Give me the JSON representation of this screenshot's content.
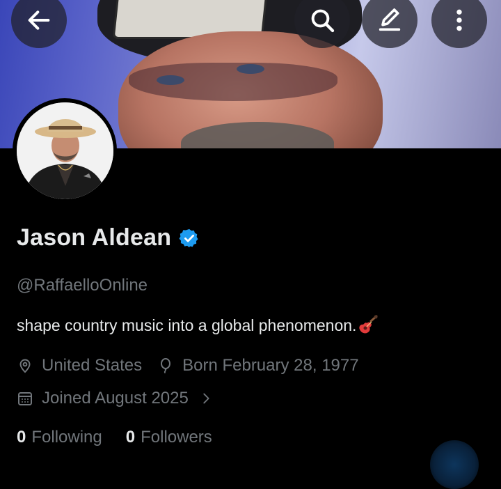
{
  "header": {
    "back_icon": "arrow-left-icon",
    "search_icon": "search-icon",
    "edit_icon": "pencil-icon",
    "more_icon": "more-vertical-icon"
  },
  "profile": {
    "name": "Jason Aldean",
    "verified": true,
    "handle": "@RaffaelloOnline",
    "bio": "shape country music into a global phenomenon.",
    "bio_emoji": "guitar-emoji",
    "location": "United States",
    "birthday": "Born February 28, 1977",
    "joined": "Joined August 2025"
  },
  "stats": {
    "following_count": "0",
    "following_label": "Following",
    "followers_count": "0",
    "followers_label": "Followers"
  },
  "colors": {
    "background": "#000000",
    "text_primary": "#e7e9ea",
    "text_secondary": "#71767b",
    "verified_blue": "#1d9bf0"
  }
}
